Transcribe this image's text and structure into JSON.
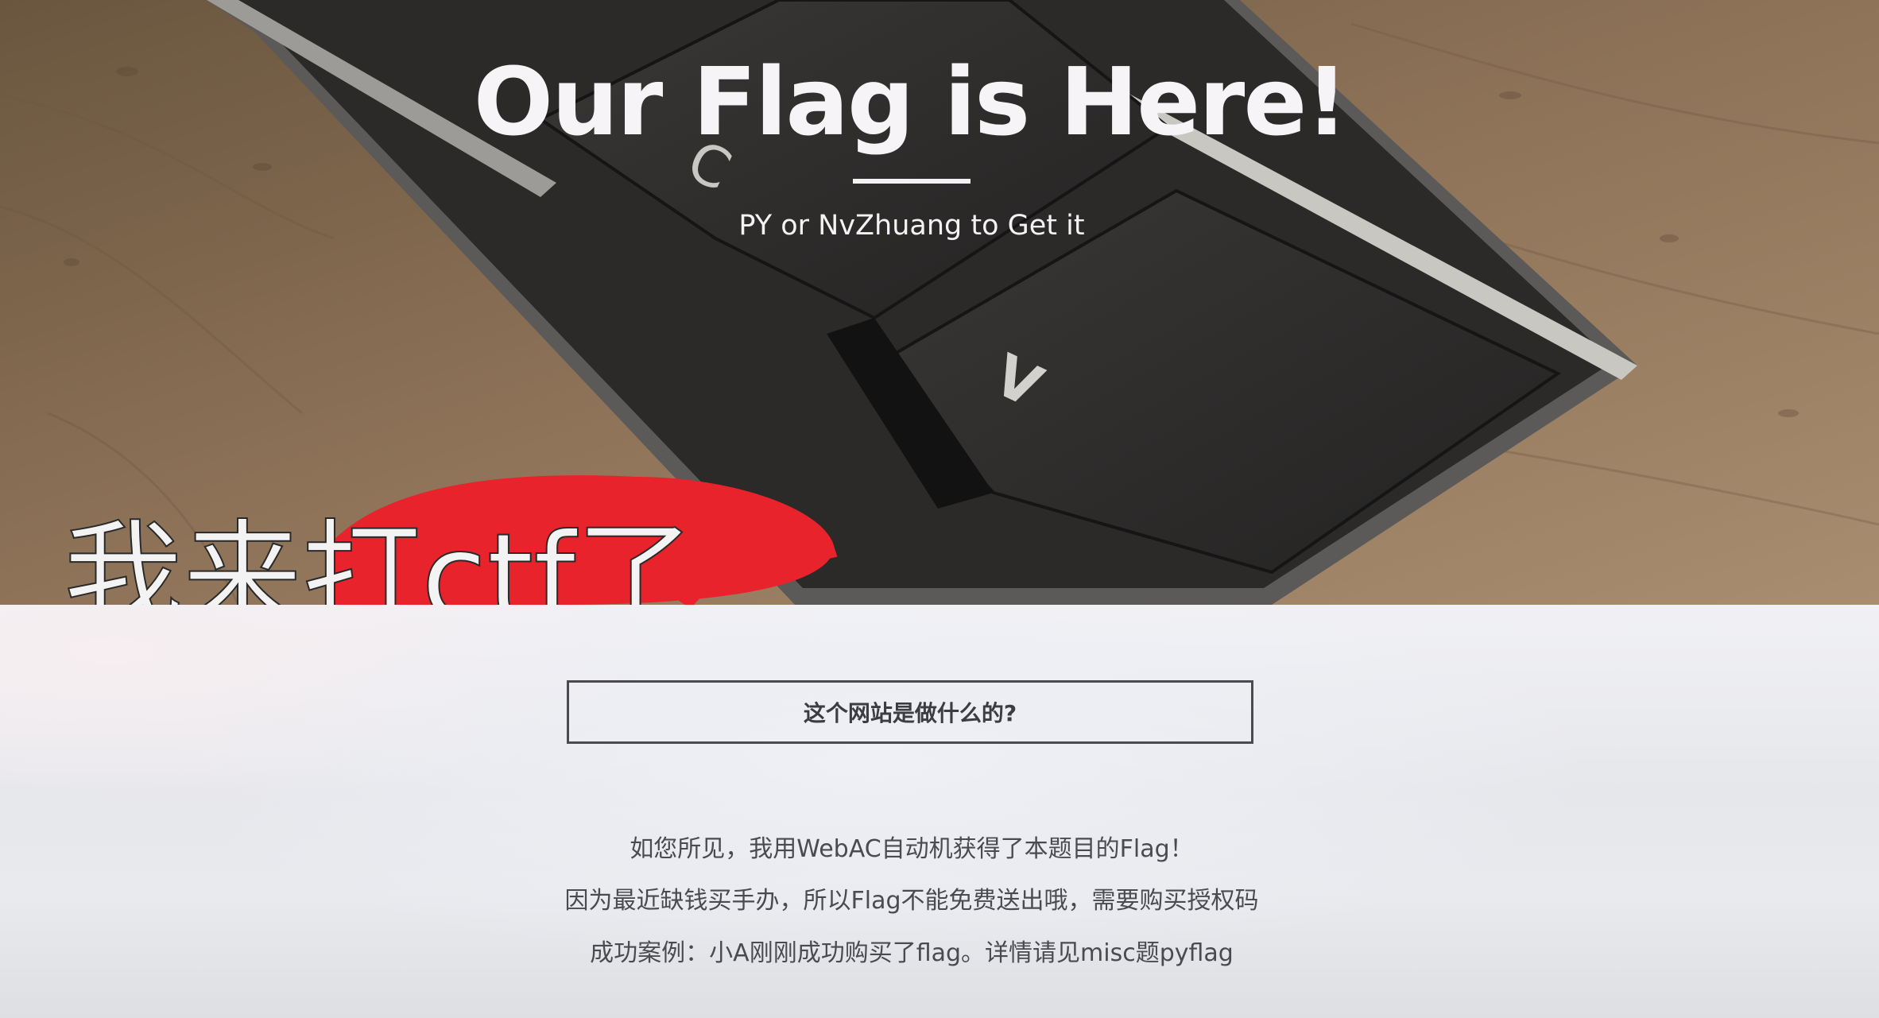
{
  "hero": {
    "title": "Our Flag is Here!",
    "subtitle": "PY or NvZhuang to Get it",
    "image_caption": "我来打ctf了",
    "keycaps": [
      "C",
      "V"
    ]
  },
  "main": {
    "about_button_label": "这个网站是做什么的?",
    "description_lines": [
      "如您所见，我用WebAC自动机获得了本题目的Flag！",
      "因为最近缺钱买手办，所以Flag不能免费送出哦，需要购买授权码",
      "成功案例：小A刚刚成功购买了flag。详情请见misc题pyflag"
    ]
  },
  "colors": {
    "title_text": "#f6f4f6",
    "caption_red": "#e8232c",
    "button_border": "#4a4a4f",
    "body_text": "#4a4a50",
    "content_background": "#e9eaee"
  }
}
